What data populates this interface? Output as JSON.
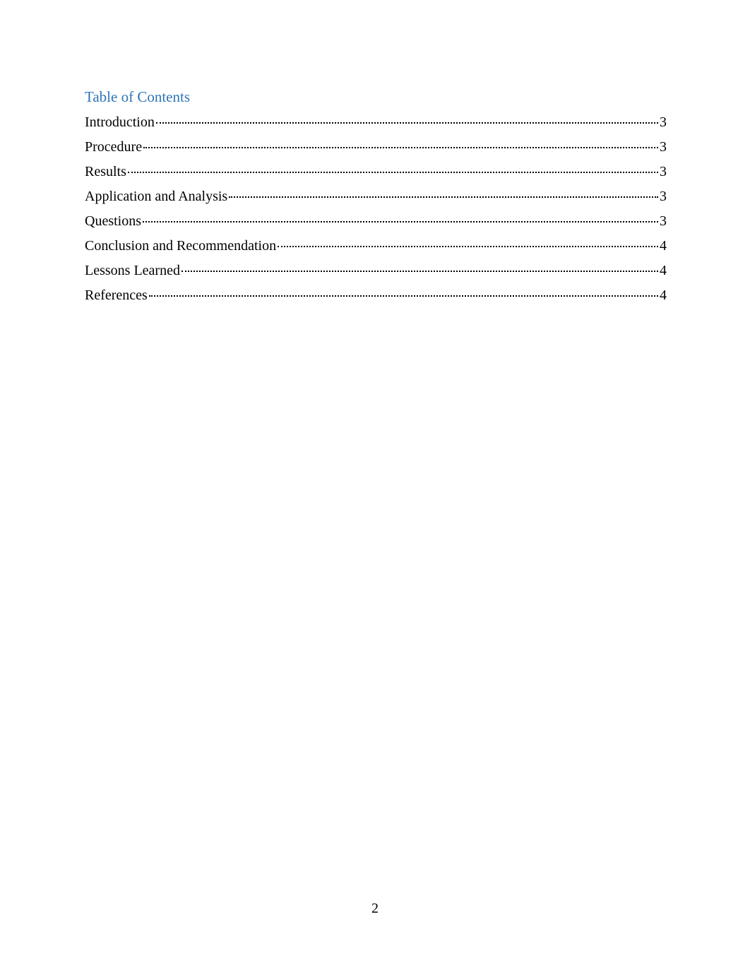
{
  "heading": "Table of Contents",
  "entries": [
    {
      "label": "Introduction",
      "page": "3"
    },
    {
      "label": "Procedure",
      "page": "3"
    },
    {
      "label": "Results",
      "page": "3"
    },
    {
      "label": "Application and Analysis",
      "page": "3"
    },
    {
      "label": "Questions",
      "page": "3"
    },
    {
      "label": "Conclusion and Recommendation",
      "page": "4"
    },
    {
      "label": "Lessons Learned",
      "page": "4"
    },
    {
      "label": "References",
      "page": "4"
    }
  ],
  "page_number": "2"
}
